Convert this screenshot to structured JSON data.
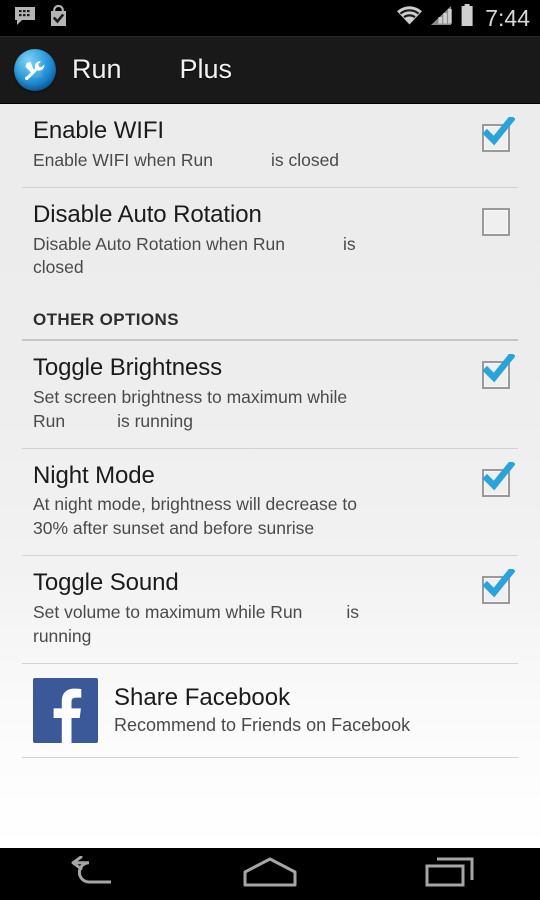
{
  "statusbar": {
    "icons": [
      "bbm-chat-icon",
      "play-store-bag-icon",
      "wifi-icon",
      "cellular-signal-icon",
      "battery-icon"
    ],
    "time": "7:44"
  },
  "actionbar": {
    "app_icon": "wrench-screwdriver-icon",
    "title": "Run",
    "title_suffix": "Plus"
  },
  "settings": {
    "items": [
      {
        "name": "enable-wifi",
        "title": "Enable WIFI",
        "summary_part1": "Enable WIFI when Run",
        "summary_part2": "is closed",
        "checked": true
      },
      {
        "name": "disable-auto-rotation",
        "title": "Disable Auto Rotation",
        "summary_part1": "Disable Auto Rotation when Run",
        "summary_part2": "is",
        "summary_part3": "closed",
        "checked": false
      }
    ]
  },
  "other_options": {
    "header": "OTHER OPTIONS",
    "items": [
      {
        "name": "toggle-brightness",
        "title": "Toggle Brightness",
        "summary_part1": "Set screen brightness to maximum while",
        "summary_part2": "Run",
        "summary_part3": "is running",
        "checked": true
      },
      {
        "name": "night-mode",
        "title": "Night Mode",
        "summary_part1": "At night mode, brightness will decrease to",
        "summary_part2": "30% after sunset and before sunrise",
        "checked": true
      },
      {
        "name": "toggle-sound",
        "title": "Toggle Sound",
        "summary_part1": "Set volume to maximum while Run",
        "summary_part2": "is",
        "summary_part3": "running",
        "checked": true
      }
    ]
  },
  "share": {
    "icon": "facebook-logo-icon",
    "title": "Share Facebook",
    "summary": "Recommend to Friends on Facebook"
  },
  "navbar": {
    "back": "back-icon",
    "home": "home-icon",
    "recents": "recents-icon"
  },
  "colors": {
    "accent_checkbox": "#29a3d8",
    "facebook_blue": "#3b5998",
    "actionbar": "#191919",
    "list_bg_top": "#ececec",
    "list_bg_bottom": "#ffffff"
  }
}
